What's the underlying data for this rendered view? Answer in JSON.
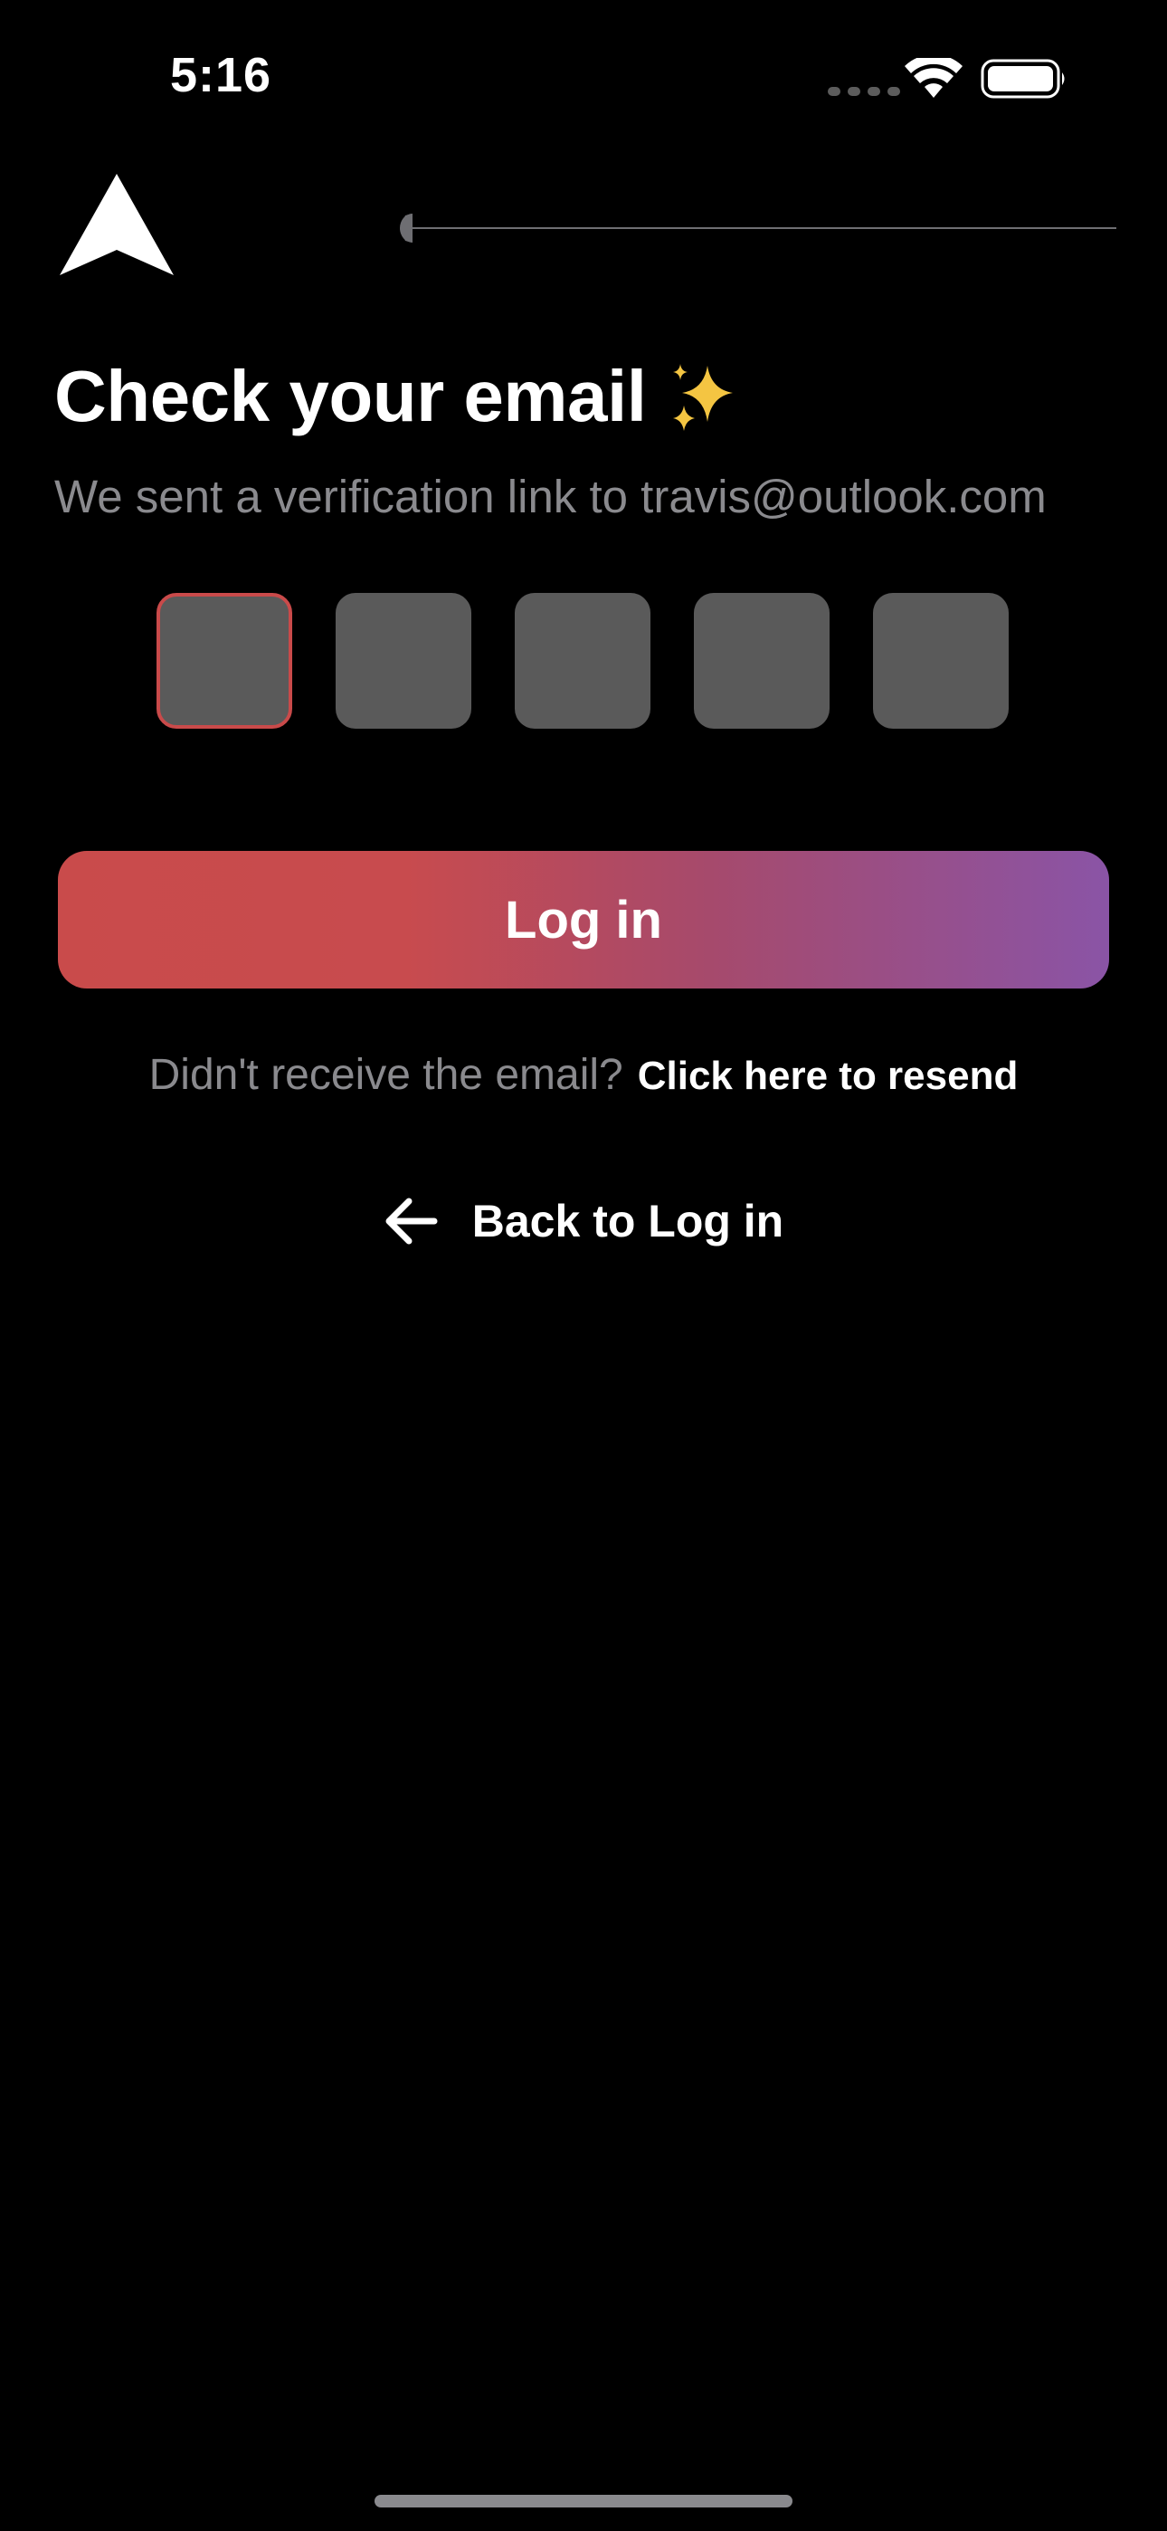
{
  "status_bar": {
    "time": "5:16",
    "icons": [
      "signal-dots-icon",
      "wifi-icon",
      "battery-icon"
    ]
  },
  "header": {
    "logo_icon": "arrowhead-logo-icon",
    "progress_fraction": 0.0
  },
  "main": {
    "title": "Check your email",
    "title_emoji_icon": "sparkles-icon",
    "subtitle": "We sent a verification link to travis@outlook.com",
    "code_inputs": [
      {
        "value": "",
        "active": true
      },
      {
        "value": "",
        "active": false
      },
      {
        "value": "",
        "active": false
      },
      {
        "value": "",
        "active": false
      },
      {
        "value": "",
        "active": false
      }
    ],
    "login_button_label": "Log in",
    "resend_prompt": "Didn't receive the email?",
    "resend_link": "Click here to resend",
    "back_label": "Back to Log in"
  },
  "colors": {
    "background": "#000000",
    "accent_red": "#c94b4b",
    "accent_purple": "#8a54a6",
    "code_box": "#5a5a5a",
    "muted_text": "#8a8a8e"
  }
}
